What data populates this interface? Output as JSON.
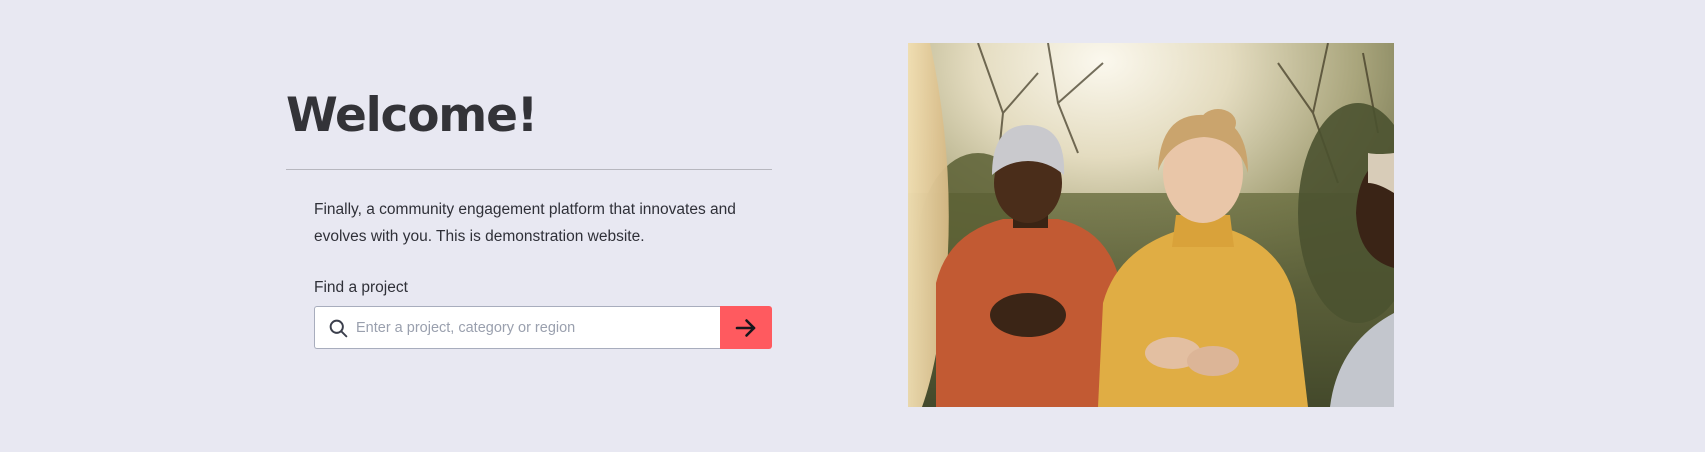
{
  "hero": {
    "title": "Welcome!",
    "intro": "Finally, a community engagement platform that innovates and evolves with you. This is demonstration website.",
    "search": {
      "label": "Find a project",
      "placeholder": "Enter a project, category or region",
      "value": "",
      "submit_icon": "arrow-right-icon"
    }
  },
  "theme": {
    "background": "#e8e8f2",
    "accent": "#ff5a5f",
    "text": "#2e2e35"
  }
}
